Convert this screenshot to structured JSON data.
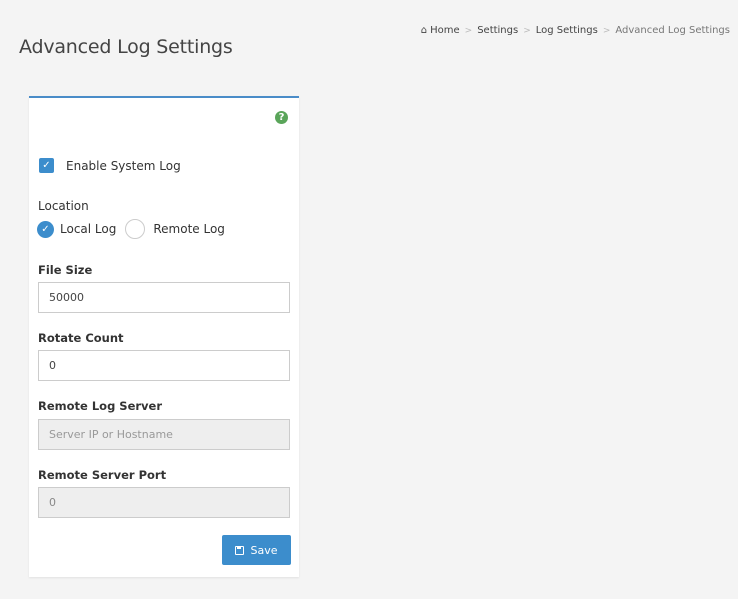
{
  "page": {
    "title": "Advanced Log Settings"
  },
  "breadcrumb": {
    "items": [
      "Home",
      "Settings",
      "Log Settings",
      "Advanced Log Settings"
    ],
    "separator": ">"
  },
  "form": {
    "help_icon": "?",
    "enable_system_log": {
      "label": "Enable System Log",
      "checked": true
    },
    "location": {
      "label": "Location",
      "options": [
        {
          "label": "Local Log",
          "selected": true
        },
        {
          "label": "Remote Log",
          "selected": false
        }
      ]
    },
    "file_size": {
      "label": "File Size",
      "value": "50000"
    },
    "rotate_count": {
      "label": "Rotate Count",
      "value": "0"
    },
    "remote_log_server": {
      "label": "Remote Log Server",
      "placeholder": "Server IP or Hostname",
      "disabled": true
    },
    "remote_server_port": {
      "label": "Remote Server Port",
      "value": "0",
      "disabled": true
    },
    "save_label": "Save"
  },
  "colors": {
    "accent": "#3c8dcc",
    "help": "#5aa55a",
    "background": "#f4f4f4"
  },
  "icons": {
    "home": "home-icon",
    "help": "question-circle-icon",
    "check": "check-icon",
    "save": "floppy-disk-icon"
  }
}
